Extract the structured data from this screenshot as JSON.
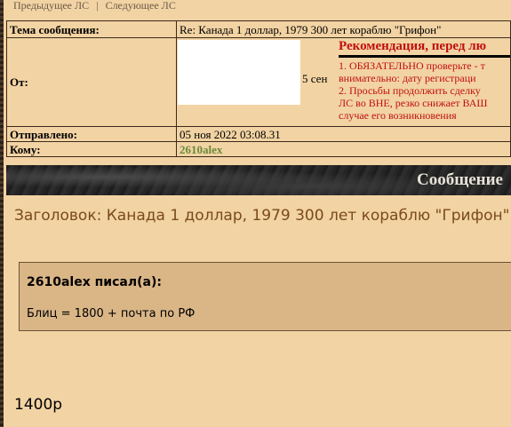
{
  "nav": {
    "prev_label": "Предыдущее ЛС",
    "separator": "|",
    "next_label": "Следующее ЛС"
  },
  "header": {
    "subject_label": "Тема сообщения:",
    "subject_value": "Re: Канада 1 доллар, 1979 300 лет кораблю \"Грифон\"",
    "from_label": "От:",
    "from_date_fragment": "5 сен",
    "sent_label": "Отправлено:",
    "sent_value": "05 ноя 2022 03:08.31",
    "to_label": "Кому:",
    "to_value": "2610alex"
  },
  "recommendation": {
    "title": "Рекомендация, перед лю",
    "line1": "1. ОБЯЗАТЕЛЬНО проверьте - т",
    "line2": "внимательно: дату регистраци",
    "line3": "2. Просьбы продолжить сделку",
    "line4": "ЛС во ВНЕ, резко снижает ВАШ",
    "line5": "случае его возникновения",
    "color": "#c01010"
  },
  "banner": {
    "title": "Сообщение"
  },
  "message": {
    "subject_line": "Заголовок: Канада 1 доллар, 1979 300 лет кораблю \"Грифон\"",
    "quote_author": "2610alex писал(а):",
    "quote_text": "Блиц = 1800 + почта по РФ",
    "reply_text": "1400р"
  },
  "colors": {
    "background": "#f2d3a3",
    "quote_background": "#dab687",
    "accent_brown": "#7a4a1c",
    "username_green": "#6a8a3a"
  }
}
